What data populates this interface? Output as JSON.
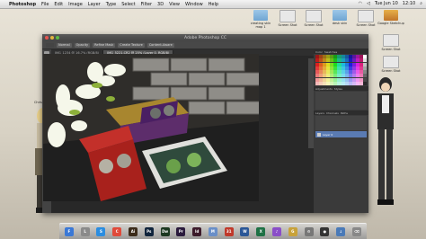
{
  "menubar": {
    "apple": "",
    "items": [
      "Photoshop",
      "File",
      "Edit",
      "Image",
      "Layer",
      "Type",
      "Select",
      "Filter",
      "3D",
      "View",
      "Window",
      "Help"
    ],
    "clock": "Tue Jun 10",
    "right_time": "12:10"
  },
  "desktop_icons": [
    {
      "label": "creating skin map 1",
      "kind": "folder"
    },
    {
      "label": "Screen Shot",
      "kind": "file"
    },
    {
      "label": "Screen Shot",
      "kind": "file"
    },
    {
      "label": "desk skin",
      "kind": "folder"
    },
    {
      "label": "Screen Shot",
      "kind": "file"
    },
    {
      "label": "Screen Shot",
      "kind": "file"
    },
    {
      "label": "Screen Shot",
      "kind": "file"
    },
    {
      "label": "Google Sketchup",
      "kind": "app"
    }
  ],
  "photoshop": {
    "window_title": "Adobe Photoshop CC",
    "options_buttons": [
      "Normal",
      "Opacity",
      "Refine Mask",
      "Create Texture",
      "Content-Aware"
    ],
    "tabs": [
      {
        "label": "IMG_1234 @ 16.7% (RGB/8)",
        "active": false
      },
      {
        "label": "IMG_5221.CR2 @ 25% (Layer 0, RGB/8)",
        "active": true
      }
    ],
    "panel_tabs_top": [
      "Color",
      "Swatches"
    ],
    "panel_tabs_mid": [
      "Adjustments",
      "Styles"
    ],
    "panel_tabs_layers": [
      "Layers",
      "Channels",
      "Paths"
    ],
    "layers": [
      {
        "name": "Layer 0",
        "selected": true
      }
    ]
  },
  "characters": [
    {
      "label": "Christa Renz",
      "position": "left"
    },
    {
      "label": "",
      "position": "right"
    }
  ],
  "dock": {
    "apps": [
      {
        "name": "Finder",
        "glyph": "F",
        "color": "#3a78d6"
      },
      {
        "name": "Launchpad",
        "glyph": "L",
        "color": "#8a8a8a"
      },
      {
        "name": "Safari",
        "glyph": "S",
        "color": "#2b8de0"
      },
      {
        "name": "Chrome",
        "glyph": "C",
        "color": "#e04a3a"
      },
      {
        "name": "Illustrator",
        "glyph": "Ai",
        "color": "#3b2b1a"
      },
      {
        "name": "Photoshop",
        "glyph": "Ps",
        "color": "#10243c"
      },
      {
        "name": "Dreamweaver",
        "glyph": "Dw",
        "color": "#1c3820"
      },
      {
        "name": "Premiere",
        "glyph": "Pr",
        "color": "#2a1a3c"
      },
      {
        "name": "InDesign",
        "glyph": "Id",
        "color": "#3c1a2a"
      },
      {
        "name": "Mail",
        "glyph": "M",
        "color": "#6a8fc8"
      },
      {
        "name": "Calendar",
        "glyph": "31",
        "color": "#c0392b"
      },
      {
        "name": "Word",
        "glyph": "W",
        "color": "#2b5797"
      },
      {
        "name": "Excel",
        "glyph": "X",
        "color": "#1e7145"
      },
      {
        "name": "Itunes",
        "glyph": "♪",
        "color": "#8a4ec8"
      },
      {
        "name": "Game",
        "glyph": "G",
        "color": "#c8a23a"
      },
      {
        "name": "Preferences",
        "glyph": "⚙",
        "color": "#777"
      },
      {
        "name": "Camera",
        "glyph": "●",
        "color": "#333"
      },
      {
        "name": "Downloads",
        "glyph": "↓",
        "color": "#4a7ab8"
      },
      {
        "name": "Trash",
        "glyph": "⌫",
        "color": "#888"
      }
    ]
  },
  "colors": {
    "ps_bg": "#393939",
    "selected_layer": "#5a7bb3"
  }
}
